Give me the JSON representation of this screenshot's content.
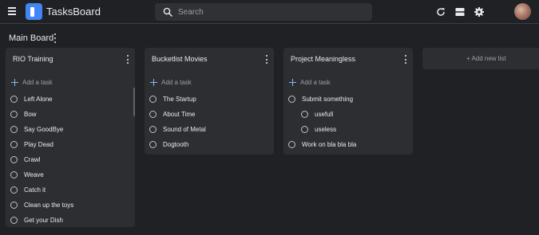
{
  "header": {
    "app_title": "TasksBoard",
    "search_placeholder": "Search",
    "icons": [
      "menu-icon",
      "refresh-icon",
      "view-toggle-icon",
      "settings-icon"
    ]
  },
  "board": {
    "title": "Main Board"
  },
  "lists": [
    {
      "title": "RIO Training",
      "add_task_label": "Add a task",
      "tasks": [
        "Left Alone",
        "Bow",
        "Say GoodBye",
        "Play Dead",
        "Crawl",
        "Weave",
        "Catch it",
        "Clean up the toys",
        "Get your Dish"
      ]
    },
    {
      "title": "Bucketlist Movies",
      "add_task_label": "Add a task",
      "tasks": [
        "The Startup",
        "About Time",
        "Sound of Metal",
        "Dogtooth"
      ]
    },
    {
      "title": "Project Meaningless",
      "add_task_label": "Add a task",
      "tasks": [
        "Submit something",
        "usefull",
        "useless",
        "Work on bla bla bla"
      ]
    }
  ],
  "new_list_label": "+ Add new list",
  "colors": {
    "background": "#202124",
    "card": "#2d2e31",
    "accent": "#4285f4",
    "add_icon": "#8ab4f8"
  }
}
